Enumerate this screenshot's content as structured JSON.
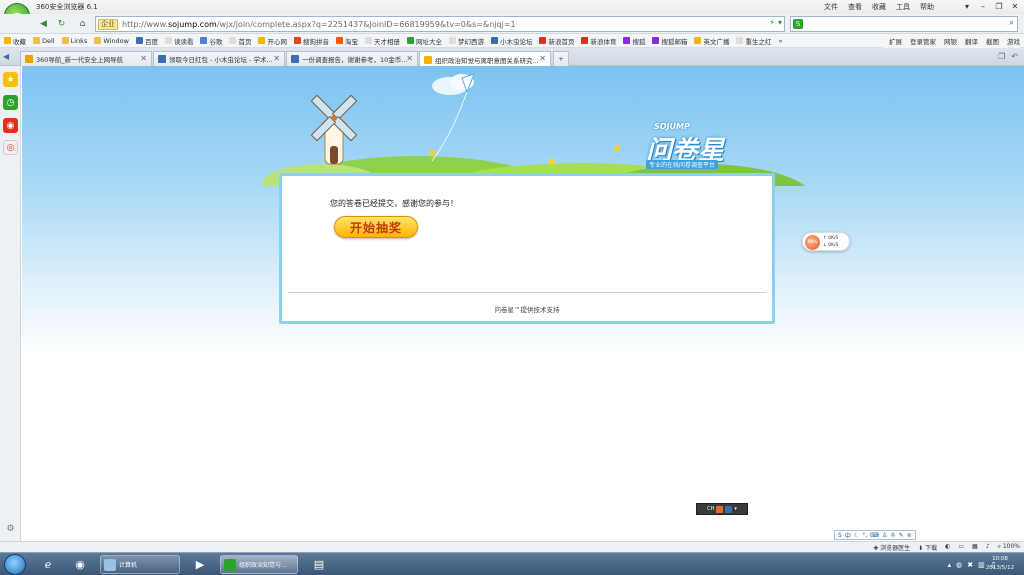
{
  "window": {
    "title": "360安全浏览器 6.1",
    "menu": [
      "文件",
      "查看",
      "收藏",
      "工具",
      "帮助"
    ],
    "controls": [
      "▾",
      "–",
      "❐",
      "✕"
    ]
  },
  "address": {
    "tag": "企业",
    "url_prefix": "http://www.",
    "url_domain": "sojump.com",
    "url_path": "/wjx/join/complete.aspx?q=2251437&JoinID=66819959&tv=0&s=&njqj=1",
    "search_placeholder": ""
  },
  "favorites": {
    "items": [
      "收藏",
      "Dell",
      "Links",
      "Window",
      "百度",
      "读读看",
      "谷歌",
      "首页",
      "开心网",
      "搜狗拼音",
      "淘宝",
      "天才相册",
      "网址大全",
      "梦幻西游",
      "小木虫论坛",
      "新浪首页",
      "新浪体育",
      "搜狐",
      "搜狐邮箱",
      "英文广播",
      "重生之红",
      "»"
    ],
    "right": [
      "扩展",
      "登录管家",
      "网银",
      "翻译",
      "截图",
      "游戏"
    ]
  },
  "tabs": [
    {
      "label": "360导航_新一代安全上网导航",
      "color": "#e8a400"
    },
    {
      "label": "领取今日红包 - 小木虫论坛 - 学术...",
      "color": "#3b6db3"
    },
    {
      "label": "一份调查报告，谢谢参考，10金币...",
      "color": "#3b6db3"
    },
    {
      "label": "组织政治知觉与离职意图关系研究...",
      "color": "#f0b400"
    }
  ],
  "sidebar": {
    "icons": [
      "star-icon",
      "clock-icon",
      "weibo-icon",
      "target-icon"
    ],
    "bottom_icon": "settings-icon"
  },
  "page": {
    "message": "您的答卷已经提交，感谢您的参与！",
    "lottery_button": "开始抽奖",
    "footer": "问卷星™提供技术支持",
    "brand_name": "问卷星",
    "brand_en": "SOJUMP",
    "brand_tag": "专业的在线问卷调查平台"
  },
  "speed_widget": {
    "percent": "69%",
    "up": "0K/S",
    "down": "0K/S"
  },
  "mini_toolbar": {
    "label": "CH"
  },
  "statusbar": {
    "items": [
      "浏览器医生",
      "下载",
      "100%"
    ]
  },
  "taskbar": {
    "tasks": [
      {
        "label": "计算机"
      },
      {
        "label": "组织政治知觉与..."
      }
    ],
    "clock_time": "10:08",
    "clock_date": "2013/5/12"
  }
}
